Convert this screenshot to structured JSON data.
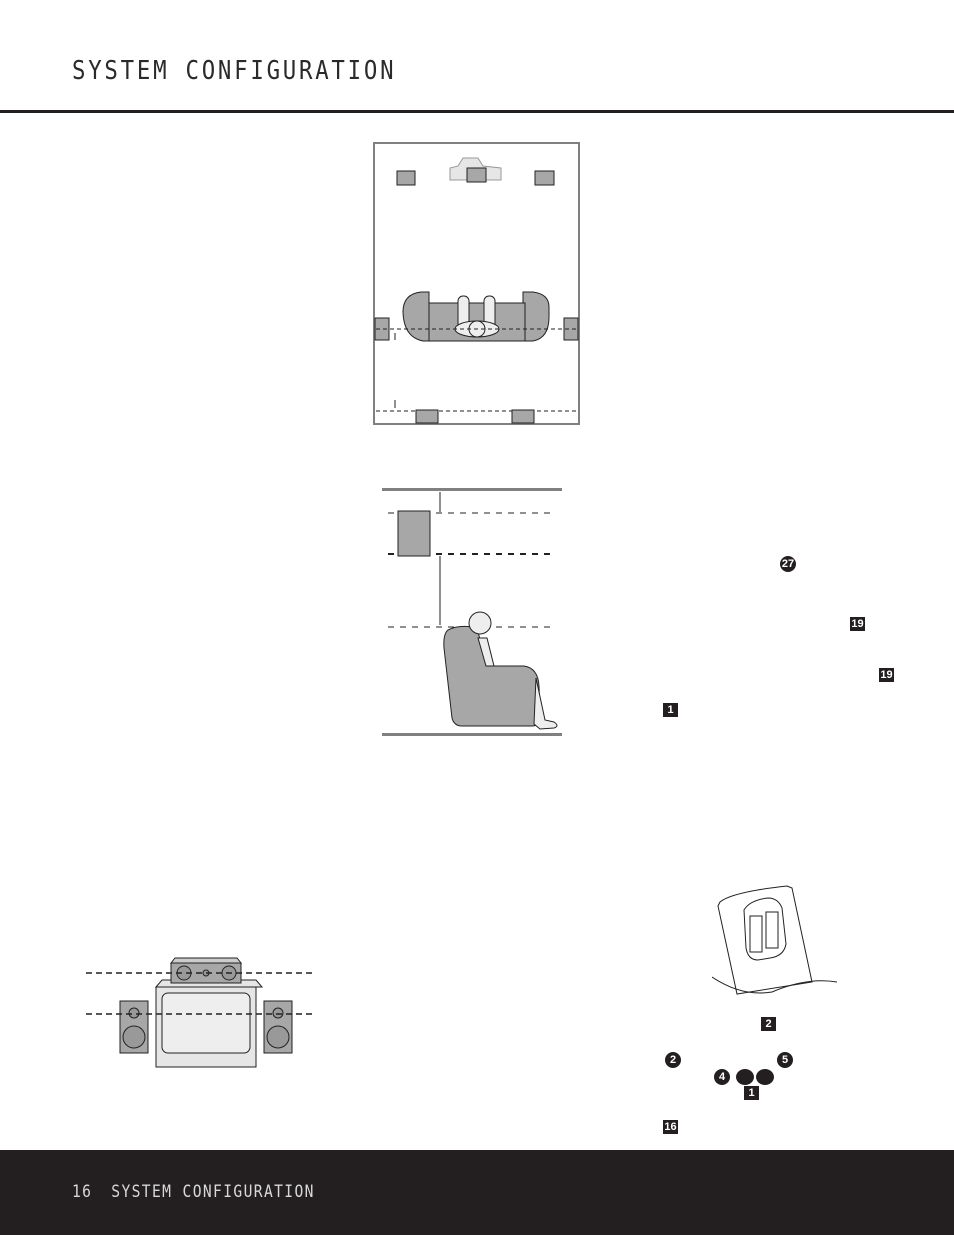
{
  "header": {
    "title": "SYSTEM CONFIGURATION"
  },
  "figures": {
    "room_top_view": {
      "description": "Top-down room layout: front left, center, front right speakers near TV, listener on sofa, side surround speakers, rear back speakers"
    },
    "side_view": {
      "description": "Side elevation: surround speaker mounted above listener ear height with distance arrows"
    },
    "front_view": {
      "description": "Front view: center speaker on TV with front left/right speakers, tweeter alignment dashed lines"
    },
    "remote_battery": {
      "description": "Remote control back with battery compartment open"
    }
  },
  "callouts": [
    {
      "label": "27",
      "shape": "circle"
    },
    {
      "label": "19",
      "shape": "square"
    },
    {
      "label": "19",
      "shape": "square"
    },
    {
      "label": "1",
      "shape": "square"
    },
    {
      "label": "2",
      "shape": "square"
    },
    {
      "label": "2",
      "shape": "circle"
    },
    {
      "label": "5",
      "shape": "circle"
    },
    {
      "label": "4",
      "shape": "circle"
    },
    {
      "label": "",
      "shape": "circle"
    },
    {
      "label": "",
      "shape": "circle"
    },
    {
      "label": "1",
      "shape": "square"
    },
    {
      "label": "16",
      "shape": "square"
    }
  ],
  "footer": {
    "page_number": "16",
    "section": "SYSTEM CONFIGURATION"
  },
  "colors": {
    "speaker_fill": "#a7a7a7",
    "light_fill": "#e6e6e6",
    "rule": "#231f20",
    "frame": "#808080"
  }
}
